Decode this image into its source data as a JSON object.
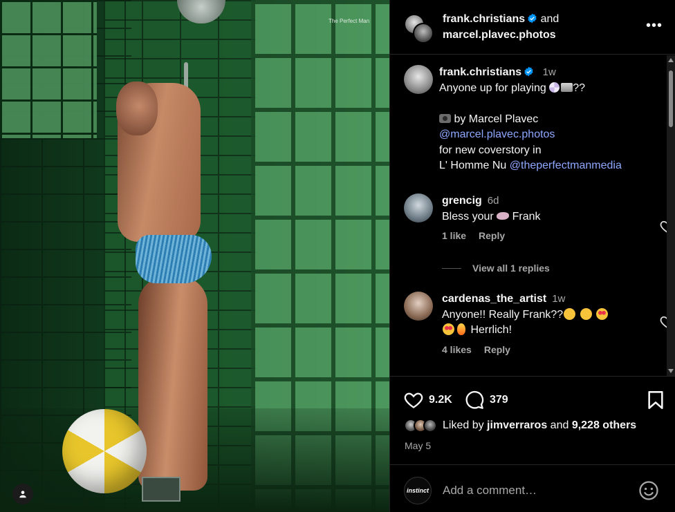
{
  "photo": {
    "watermark": "The Perfect Man",
    "user_tag_icon": "person-icon"
  },
  "header": {
    "user1": "frank.christians",
    "conjunction": "and",
    "user2": "marcel.plavec.photos",
    "more_icon": "more-options-icon",
    "more_glyph": "•••"
  },
  "caption": {
    "username": "frank.christians",
    "time": "1w",
    "line1_text": "Anyone up for playing ",
    "line1_suffix": "??",
    "line2_prefix": " by Marcel Plavec",
    "line3_link": "@marcel.plavec.photos",
    "line4": "for new coverstory in",
    "line5_text": "L' Homme Nu ",
    "line5_link": "@theperfectmanmedia"
  },
  "comments": [
    {
      "username": "grencig",
      "time": "6d",
      "text_before": "Bless your ",
      "text_after": " Frank",
      "likes": "1 like",
      "reply": "Reply"
    },
    {
      "username": "cardenas_the_artist",
      "time": "1w",
      "text_line1": "Anyone!! Really Frank??",
      "text_line2": " Herrlich!",
      "likes": "4 likes",
      "reply": "Reply"
    }
  ],
  "view_replies": "View all 1 replies",
  "actions": {
    "likes_count": "9.2K",
    "comments_count": "379",
    "liked_by_prefix": "Liked by ",
    "liked_by_user": "jimverraros",
    "liked_by_middle": " and ",
    "liked_by_others": "9,228 others",
    "date": "May 5"
  },
  "add_comment": {
    "avatar_label": "instinct",
    "placeholder": "Add a comment…"
  },
  "colors": {
    "link": "#8ea8ff",
    "verified": "#0095f6",
    "muted": "#a8a8a8"
  }
}
